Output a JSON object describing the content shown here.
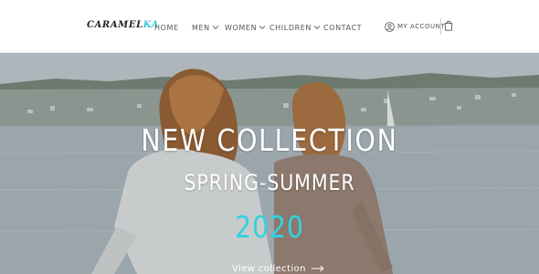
{
  "header": {
    "logo_part1": "CARAMEL",
    "logo_part2": "KA",
    "nav": {
      "home": "HOME",
      "men": "MEN",
      "women": "WOMEN",
      "children": "CHILDREN",
      "contact": "CONTACT"
    },
    "account_label": "MY ACCOUNT"
  },
  "hero": {
    "title": "NEW COLLECTION",
    "subtitle": "SPRING-SUMMER",
    "year": "2020",
    "link_label": "View collection"
  },
  "colors": {
    "accent": "#2fd3e3",
    "text_dark": "#555555",
    "hero_text": "#ffffff"
  },
  "icons": {
    "account": "user-circle-icon",
    "cart": "shopping-bag-icon",
    "dropdown": "chevron-down-icon",
    "link": "arrow-right-icon"
  }
}
